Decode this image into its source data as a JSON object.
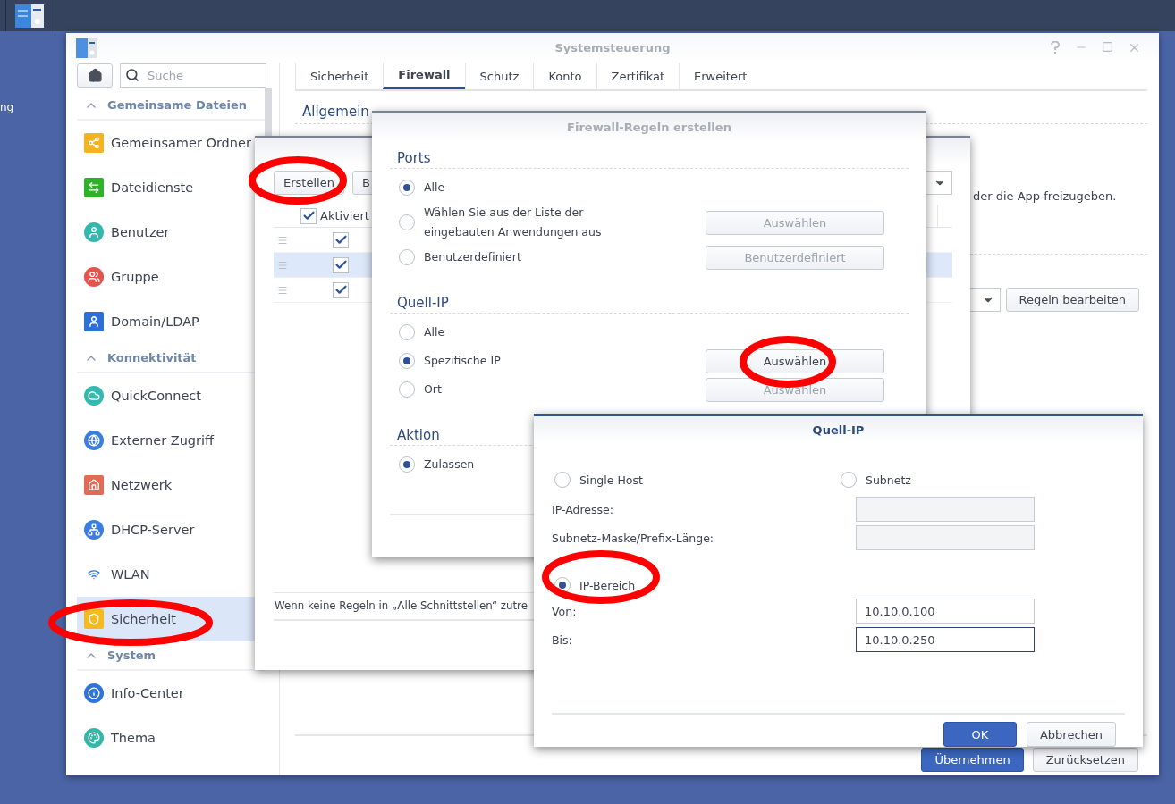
{
  "desktop": {
    "icon_label": "ng"
  },
  "window": {
    "title": "Systemsteuerung"
  },
  "sidebar": {
    "search": {
      "placeholder": "Suche"
    },
    "sections": [
      {
        "title": "Gemeinsame Dateien",
        "expanded": true,
        "items": [
          {
            "label": "Gemeinsamer Ordner",
            "kind": "shared-folder",
            "selected": false
          },
          {
            "label": "Dateidienste",
            "kind": "file-services",
            "selected": false
          },
          {
            "label": "Benutzer",
            "kind": "user",
            "selected": false
          },
          {
            "label": "Gruppe",
            "kind": "group",
            "selected": false
          },
          {
            "label": "Domain/LDAP",
            "kind": "domain",
            "selected": false
          }
        ]
      },
      {
        "title": "Konnektivität",
        "expanded": true,
        "items": [
          {
            "label": "QuickConnect",
            "kind": "quickconnect",
            "selected": false
          },
          {
            "label": "Externer Zugriff",
            "kind": "globe",
            "selected": false
          },
          {
            "label": "Netzwerk",
            "kind": "network",
            "selected": false
          },
          {
            "label": "DHCP-Server",
            "kind": "dhcp",
            "selected": false
          },
          {
            "label": "WLAN",
            "kind": "wifi",
            "selected": false
          },
          {
            "label": "Sicherheit",
            "kind": "shield",
            "selected": true
          }
        ]
      },
      {
        "title": "System",
        "expanded": true,
        "items": [
          {
            "label": "Info-Center",
            "kind": "info",
            "selected": false
          },
          {
            "label": "Thema",
            "kind": "palette",
            "selected": false
          }
        ]
      }
    ]
  },
  "tabs": [
    {
      "label": "Sicherheit",
      "selected": false
    },
    {
      "label": "Firewall",
      "selected": true
    },
    {
      "label": "Schutz",
      "selected": false
    },
    {
      "label": "Konto",
      "selected": false
    },
    {
      "label": "Zertifikat",
      "selected": false
    },
    {
      "label": "Erweitert",
      "selected": false
    }
  ],
  "general_heading": "Allgemein",
  "description_tail": "der die App freizugeben.",
  "rules_button": "Regeln bearbeiten",
  "footer_buttons": [
    {
      "label": "Übernehmen",
      "kind": "primary"
    },
    {
      "label": "Zurücksetzen",
      "kind": "secondary"
    }
  ],
  "rules_window": {
    "buttons": [
      "Erstellen",
      "B"
    ],
    "header_checkbox": {
      "label": "Aktiviert",
      "checked": true
    },
    "rows": [
      {
        "checked": true,
        "selected": false
      },
      {
        "checked": true,
        "selected": true
      },
      {
        "checked": true,
        "selected": false
      }
    ],
    "note": "Wenn keine Regeln in „Alle Schnittstellen“ zutre"
  },
  "create_dialog": {
    "title": "Firewall-Regeln erstellen",
    "sections": [
      {
        "title": "Ports",
        "options": [
          {
            "label": "Alle",
            "selected": true
          },
          {
            "label": "Wählen Sie aus der Liste der eingebauten Anwendungen aus",
            "selected": false,
            "button": {
              "label": "Auswählen",
              "disabled": true
            }
          },
          {
            "label": "Benutzerdefiniert",
            "selected": false,
            "button": {
              "label": "Benutzerdefiniert",
              "disabled": true
            }
          }
        ]
      },
      {
        "title": "Quell-IP",
        "options": [
          {
            "label": "Alle",
            "selected": false
          },
          {
            "label": "Spezifische IP",
            "selected": true,
            "button": {
              "label": "Auswählen",
              "disabled": false
            }
          },
          {
            "label": "Ort",
            "selected": false,
            "button": {
              "label": "Auswählen",
              "disabled": true
            }
          }
        ]
      },
      {
        "title": "Aktion",
        "options": [
          {
            "label": "Zulassen",
            "selected": true
          }
        ]
      }
    ]
  },
  "source_ip_dialog": {
    "title": "Quell-IP",
    "modes": [
      {
        "label": "Single Host",
        "selected": false,
        "fields": [
          {
            "label": "IP-Adresse:",
            "disabled": true,
            "focused": false
          },
          {
            "label": "Subnetz-Maske/Prefix-Länge:",
            "disabled": true,
            "focused": false
          }
        ]
      },
      {
        "label": "Subnetz",
        "selected": false
      },
      {
        "label": "IP-Bereich",
        "selected": true,
        "fields": [
          {
            "label": "Von:",
            "value": "10.10.0.100",
            "disabled": false,
            "focused": false
          },
          {
            "label": "Bis:",
            "value": "10.10.0.250",
            "disabled": false,
            "focused": true
          }
        ]
      }
    ],
    "buttons": [
      {
        "label": "OK",
        "kind": "primary"
      },
      {
        "label": "Abbrechen",
        "kind": "secondary"
      }
    ]
  }
}
